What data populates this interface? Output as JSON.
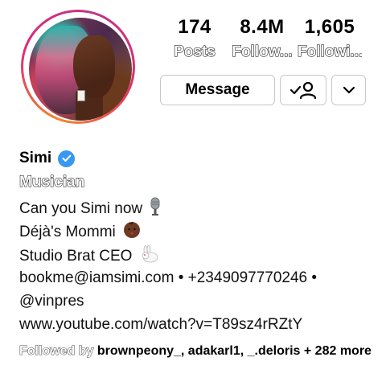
{
  "profile": {
    "name": "Simi",
    "category": "Musician",
    "bio_lines": [
      "Can you Simi now",
      "Déjà's Mommi",
      "Studio Brat CEO",
      "bookme@iamsimi.com • +2349097770246 •",
      "@vinpres",
      "www.youtube.com/watch?v=T89sz4rRZtY"
    ],
    "followed_by_label": "Followed by",
    "followed_by_names": "brownpeony_, adakarl1, _.deloris",
    "followed_by_more": "+ 282 more"
  },
  "stats": {
    "posts": {
      "value": "174",
      "label": "Posts"
    },
    "followers": {
      "value": "8.4M",
      "label": "Follow..."
    },
    "following": {
      "value": "1,605",
      "label": "Followi..."
    }
  },
  "actions": {
    "message_label": "Message"
  },
  "icons": {
    "verified": "verified-badge-icon",
    "suggest": "add-person-check-icon",
    "more": "chevron-down-icon",
    "mic": "microphone-icon",
    "baby": "baby-icon",
    "rabbit": "rabbit-icon"
  },
  "colors": {
    "verified": "#3897f0",
    "ring_start": "#f58529",
    "ring_end": "#dd2a7b"
  }
}
